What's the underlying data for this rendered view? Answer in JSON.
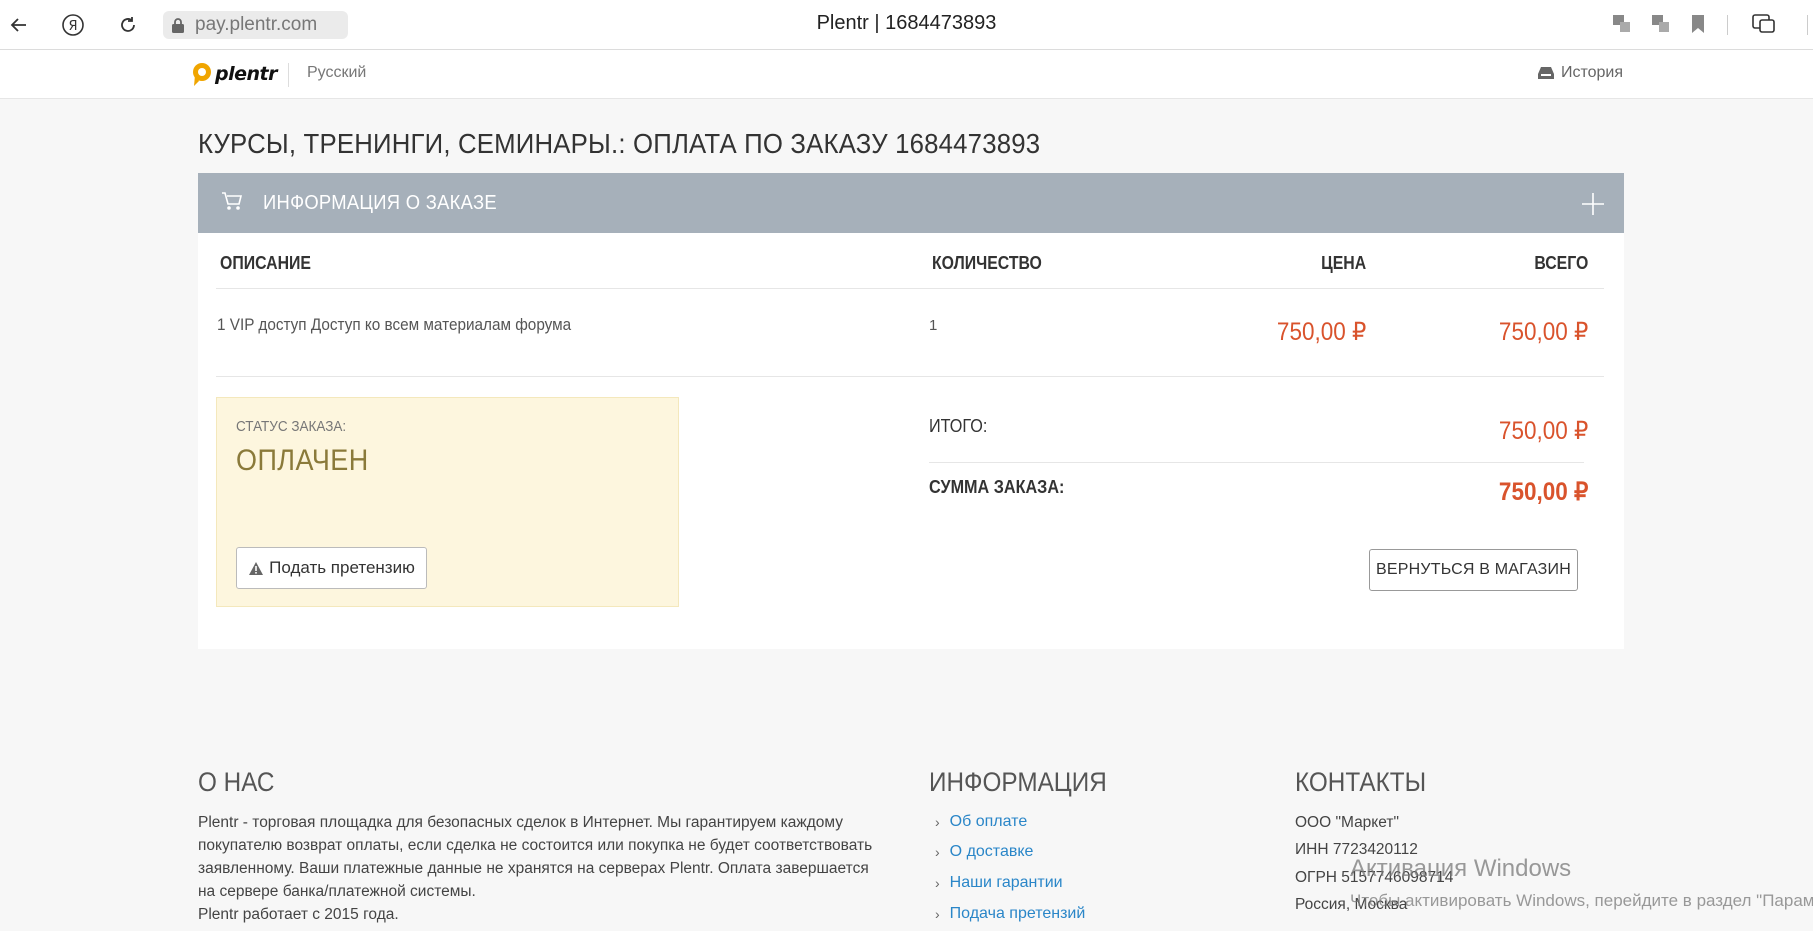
{
  "browser": {
    "url": "pay.plentr.com",
    "tab_title": "Plentr | 1684473893"
  },
  "header": {
    "logo_text": "plentr",
    "language": "Русский",
    "history_label": "История"
  },
  "page": {
    "title": "КУРСЫ, ТРЕНИНГИ, СЕМИНАРЫ.: ОПЛАТА ПО ЗАКАЗУ 1684473893"
  },
  "order": {
    "section_title": "ИНФОРМАЦИЯ О ЗАКАЗЕ",
    "columns": {
      "description": "ОПИСАНИЕ",
      "quantity": "КОЛИЧЕСТВО",
      "price": "ЦЕНА",
      "total": "ВСЕГО"
    },
    "items": [
      {
        "description": "1 VIP доступ Доступ ко всем материалам форума",
        "quantity": "1",
        "price": "750,00 ₽",
        "total": "750,00 ₽"
      }
    ],
    "status_label": "СТАТУС ЗАКАЗА:",
    "status_value": "ОПЛАЧЕН",
    "claim_button": "Подать претензию",
    "subtotal_label": "ИТОГО:",
    "subtotal_value": "750,00 ₽",
    "sum_label": "СУММА ЗАКАЗА:",
    "sum_value": "750,00 ₽",
    "return_button": "ВЕРНУТЬСЯ В МАГАЗИН"
  },
  "footer": {
    "about_title": "О НАС",
    "about_text_1": "Plentr - торговая площадка для безопасных сделок в Интернет. Мы гарантируем каждому покупателю возврат оплаты, если сделка не состоится или покупка не будет соответствовать заявленному. Ваши платежные данные не хранятся на серверах Plentr. Оплата завершается на сервере банка/платежной системы.",
    "about_text_2": "Plentr работает с 2015 года.",
    "info_title": "ИНФОРМАЦИЯ",
    "info_links": [
      "Об оплате",
      "О доставке",
      "Наши гарантии",
      "Подача претензий"
    ],
    "contacts_title": "КОНТАКТЫ",
    "contacts": [
      "ООО \"Маркет\"",
      "ИНН 7723420112",
      "ОГРН 5157746098714",
      "Россия, Москва"
    ]
  },
  "windows_activation": {
    "title": "Активация Windows",
    "text": "Чтобы активировать Windows, перейдите в раздел \"Параметры\"."
  },
  "colors": {
    "accent_price": "#d9532c",
    "card_header": "#a6b0ba",
    "status_bg": "#fdf6de",
    "link": "#2a86c8"
  }
}
